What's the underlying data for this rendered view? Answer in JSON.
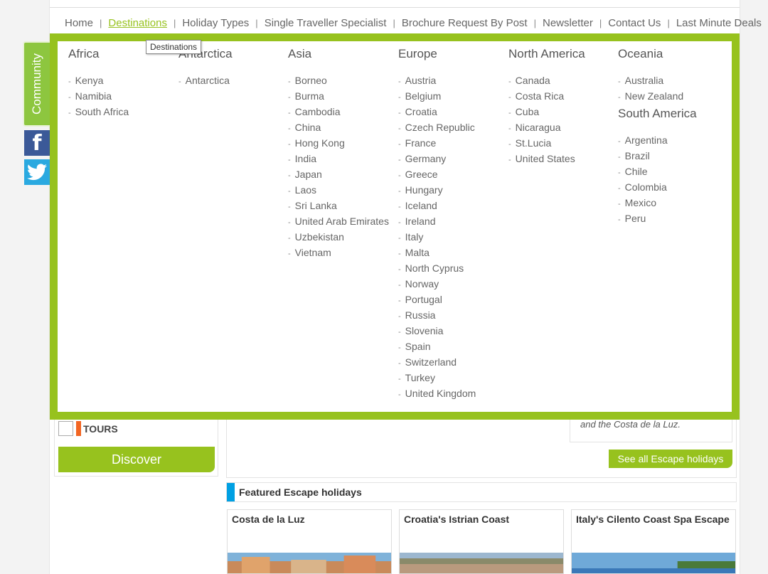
{
  "nav": {
    "items": [
      {
        "label": "Home",
        "active": false
      },
      {
        "label": "Destinations",
        "active": true
      },
      {
        "label": "Holiday Types",
        "active": false
      },
      {
        "label": "Single Traveller Specialist",
        "active": false
      },
      {
        "label": "Brochure Request By Post",
        "active": false
      },
      {
        "label": "Newsletter",
        "active": false
      },
      {
        "label": "Contact Us",
        "active": false
      },
      {
        "label": "Last Minute Deals",
        "active": false
      }
    ],
    "separator": "|",
    "tooltip": "Destinations"
  },
  "social": {
    "community_label": "Community",
    "facebook_glyph": "f",
    "colors": {
      "community": "#8dc63f",
      "facebook": "#3b5998",
      "twitter": "#2aa9e0"
    }
  },
  "megamenu": {
    "accent": "#97c21e",
    "bullet": "-",
    "columns": [
      {
        "regions": [
          {
            "title": "Africa",
            "items": [
              "Kenya",
              "Namibia",
              "South Africa"
            ]
          }
        ]
      },
      {
        "regions": [
          {
            "title": "Antarctica",
            "items": [
              "Antarctica"
            ]
          }
        ]
      },
      {
        "regions": [
          {
            "title": "Asia",
            "items": [
              "Borneo",
              "Burma",
              "Cambodia",
              "China",
              "Hong Kong",
              "India",
              "Japan",
              "Laos",
              "Sri Lanka",
              "United Arab Emirates",
              "Uzbekistan",
              "Vietnam"
            ]
          }
        ]
      },
      {
        "regions": [
          {
            "title": "Europe",
            "items": [
              "Austria",
              "Belgium",
              "Croatia",
              "Czech Republic",
              "France",
              "Germany",
              "Greece",
              "Hungary",
              "Iceland",
              "Ireland",
              "Italy",
              "Malta",
              "North Cyprus",
              "Norway",
              "Portugal",
              "Russia",
              "Slovenia",
              "Spain",
              "Switzerland",
              "Turkey",
              "United Kingdom"
            ]
          }
        ]
      },
      {
        "regions": [
          {
            "title": "North America",
            "items": [
              "Canada",
              "Costa Rica",
              "Cuba",
              "Nicaragua",
              "St.Lucia",
              "United States"
            ]
          }
        ]
      },
      {
        "regions": [
          {
            "title": "Oceania",
            "items": [
              "Australia",
              "New Zealand"
            ]
          },
          {
            "title": "South America",
            "items": [
              "Argentina",
              "Brazil",
              "Chile",
              "Colombia",
              "Mexico",
              "Peru"
            ]
          }
        ]
      }
    ]
  },
  "filter": {
    "tours_label": "TOURS",
    "discover_label": "Discover"
  },
  "escape": {
    "quote_text": "and the Costa de la Luz.",
    "see_all_label": "See all Escape holidays",
    "featured_title": "Featured Escape holidays",
    "cards": [
      {
        "title": "Costa de la Luz"
      },
      {
        "title": "Croatia's Istrian Coast"
      },
      {
        "title": "Italy's Cilento Coast Spa Escape"
      }
    ]
  }
}
